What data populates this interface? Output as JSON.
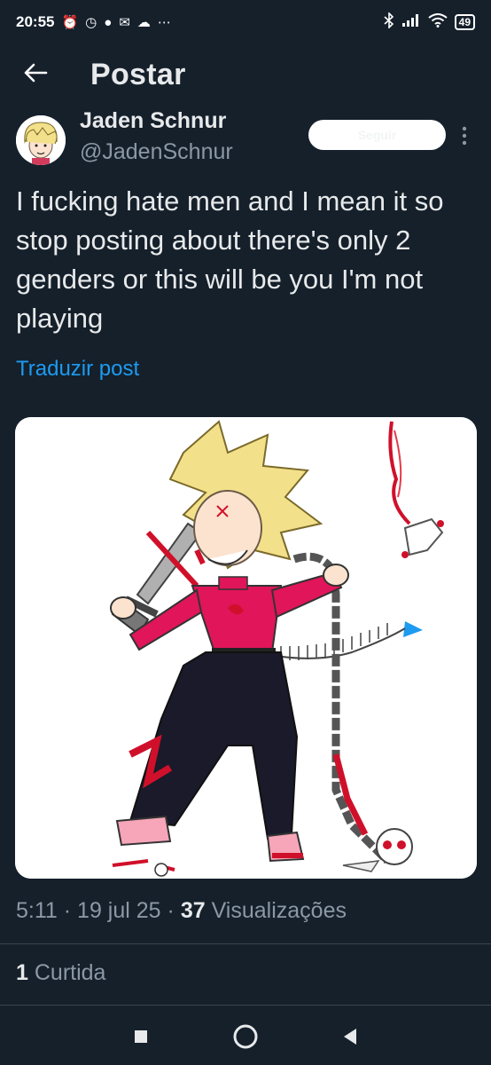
{
  "status_bar": {
    "time": "20:55",
    "icons_left": [
      "alarm-off-icon",
      "alarm-icon",
      "messenger-icon",
      "mail-icon",
      "cloud-icon",
      "more-dots-icon"
    ],
    "icons_right": [
      "bluetooth-icon",
      "signal-icon",
      "wifi-icon"
    ],
    "battery": "49"
  },
  "header": {
    "title": "Postar",
    "back_icon": "arrow-left-icon"
  },
  "author": {
    "name": "Jaden Schnur",
    "handle": "@JadenSchnur",
    "follow_label": "Seguir"
  },
  "post": {
    "text": "I fucking hate men and I mean it so stop posting about there's only 2 genders or this will be you I'm not playing",
    "translate_label": "Traduzir post"
  },
  "meta": {
    "time": "5:11",
    "date": "19 jul 25",
    "views_count": "37",
    "views_label": "Visualizações",
    "sep": "·"
  },
  "likes": {
    "count": "1",
    "label": "Curtida"
  },
  "colors": {
    "background": "#15202b",
    "link": "#1d9bf0",
    "muted": "#8b98a5",
    "text": "#e7e9ea"
  }
}
